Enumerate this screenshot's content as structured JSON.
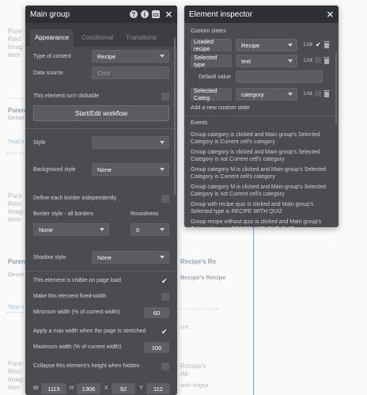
{
  "background": {
    "blocks": [
      {
        "lines": [
          "Pare",
          "Reci",
          "Imag",
          "item"
        ]
      },
      {
        "lines": [
          "Pare",
          "Reci",
          "Imag",
          "item"
        ]
      },
      {
        "lines": [
          "Pare",
          "Reci",
          "Imag",
          "item"
        ]
      }
    ],
    "bold_labels": [
      "Parent",
      "Parent"
    ],
    "muted_labels": [
      "Descr",
      "Descr"
    ],
    "total_labels": [
      "Total v",
      "Total v"
    ],
    "right_labels": [
      "Recipe's Re",
      "Recipe's Recipe"
    ],
    "right_misc": [
      "ore"
    ],
    "bottom_right_lines": [
      "Recipe's",
      "All",
      "with Imgux"
    ]
  },
  "main_group": {
    "title": "Main group",
    "tabs": [
      "Appearance",
      "Conditional",
      "Transitions"
    ],
    "type_of_content_label": "Type of content",
    "type_of_content_value": "Recipe",
    "data_source_label": "Data source",
    "data_source_placeholder": "Click",
    "not_clickable_label": "This element isn't clickable",
    "workflow_button": "Start/Edit workflow",
    "style_label": "Style",
    "background_style_label": "Background style",
    "background_style_value": "None",
    "border_each_label": "Define each border independently",
    "border_style_label": "Border style - all borders",
    "border_style_value": "None",
    "roundness_label": "Roundness",
    "roundness_value": "0",
    "shadow_style_label": "Shadow style",
    "shadow_style_value": "None",
    "visible_on_load_label": "This element is visible on page load",
    "fixed_width_label": "Make this element fixed-width",
    "min_width_label": "Minimum width (% of current width)",
    "min_width_value": "60",
    "max_width_stretch_label": "Apply a max width when the page is stretched",
    "max_width_label": "Maximum width (% of current width)",
    "max_width_value": "100",
    "collapse_label": "Collapse this element's height when hidden",
    "geometry": {
      "w_label": "W",
      "w": "1115",
      "h_label": "H",
      "h": "1306",
      "x_label": "X",
      "x": "92",
      "y_label": "Y",
      "y": "112"
    }
  },
  "inspector": {
    "title": "Element inspector",
    "custom_states_label": "Custom states",
    "states": [
      {
        "name": "Loaded recipe",
        "type": "Recipe",
        "list": "List"
      },
      {
        "name": "Selected type",
        "type": "text",
        "list": "List"
      }
    ],
    "default_value_label": "Default value",
    "state3": {
      "name": "Selected Categ",
      "type": "category",
      "list": "List"
    },
    "add_state": "Add a new custom state",
    "events_label": "Events",
    "events": [
      "Group category is clicked and Main group's Selected Category is Current cell's category",
      "Group category is clicked and Main group's Selected Category is not Current cell's category",
      "Group category M is clicked and Main group's Selected Category is Current cell's category",
      "Group category M is clicked and Main group's Selected Category is not Current cell's category",
      "Group with recipe quiz is clicked and Main group's Selected type is RECIPE WITH QUIZ",
      "Group recipe without quiz is clicked and Main group's Selected type is RECIPE WITHOUT QUIZ"
    ]
  }
}
